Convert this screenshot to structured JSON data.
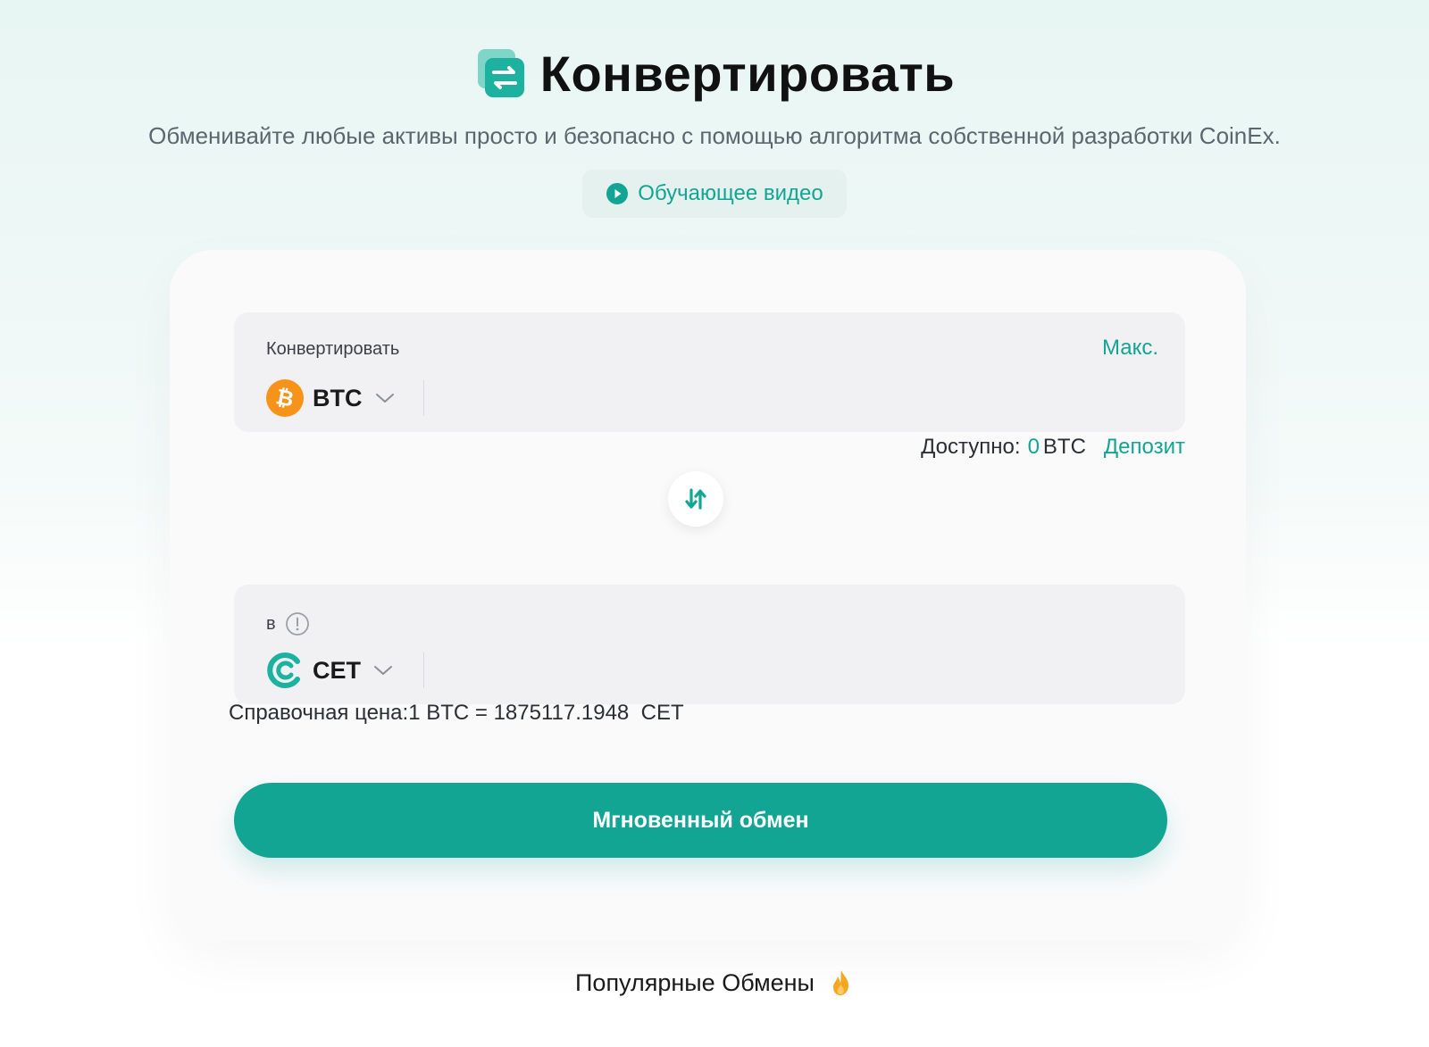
{
  "header": {
    "title": "Конвертировать",
    "subtitle": "Обменивайте любые активы просто и безопасно с помощью алгоритма собственной разработки CoinEx.",
    "tutorial_label": "Обучающее видео"
  },
  "from": {
    "label": "Конвертировать",
    "max_label": "Макс.",
    "coin": "BTC",
    "amount": "",
    "coin_icon": "bitcoin-icon"
  },
  "available": {
    "label": "Доступно:",
    "value": "0",
    "unit": "BTC",
    "deposit_label": "Депозит"
  },
  "to": {
    "label": "в",
    "coin": "CET",
    "amount": "",
    "coin_icon": "coinex-icon"
  },
  "reference_price": {
    "label": "Справочная цена:",
    "base": "1 BTC",
    "equals": "=",
    "value": "1875117.1948",
    "quote": "CET"
  },
  "exchange_button": "Мгновенный обмен",
  "popular": {
    "label": "Популярные Обмены"
  },
  "colors": {
    "accent": "#12a594",
    "btc": "#f7931a"
  }
}
